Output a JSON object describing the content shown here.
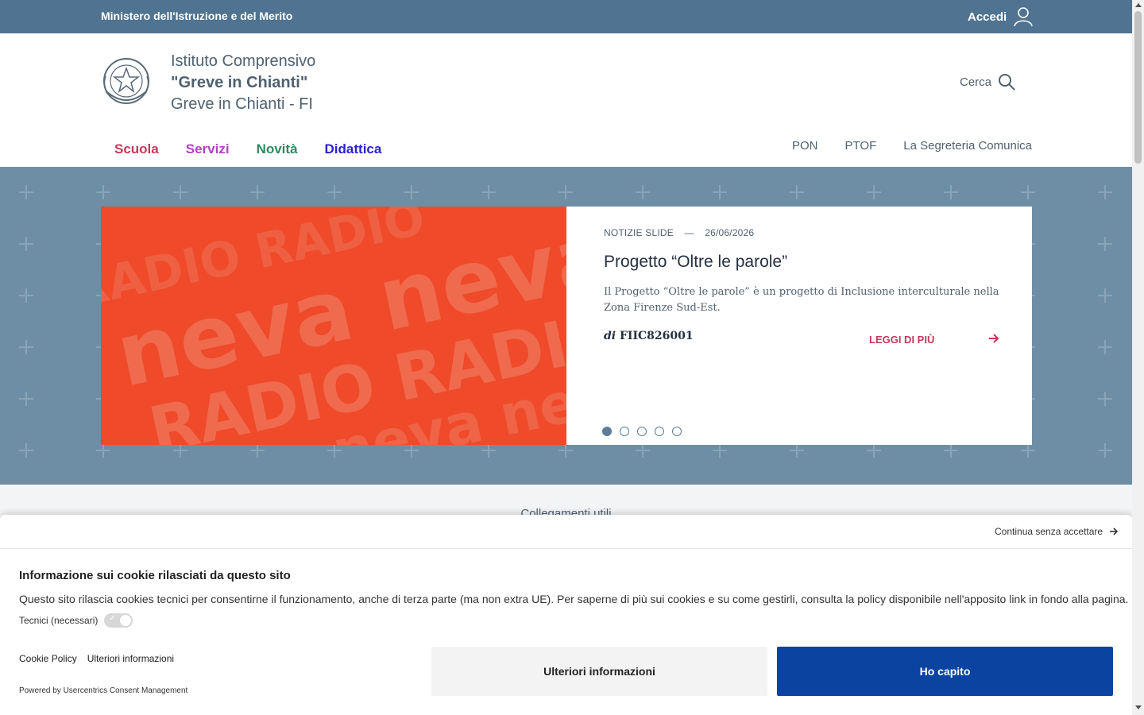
{
  "topbar": {
    "ministry": "Ministero dell'Istruzione e del Merito",
    "login_label": "Accedi"
  },
  "header": {
    "line1": "Istituto Comprensivo",
    "line2": "\"Greve in Chianti\"",
    "line3": "Greve in Chianti - FI",
    "search_label": "Cerca"
  },
  "mainnav": [
    "Scuola",
    "Servizi",
    "Novità",
    "Didattica"
  ],
  "subnav": [
    "PON",
    "PTOF",
    "La Segreteria Comunica"
  ],
  "slide": {
    "image_text_1": "neva neva",
    "image_text_2": "RADIO RADIO",
    "category": "NOTIZIE SLIDE",
    "separator": "—",
    "date": "26/06/2026",
    "title": "Progetto “Oltre le parole”",
    "description": "Il Progetto “Oltre le parole” è un progetto di Inclusione interculturale nella Zona Firenze Sud-Est.",
    "author_prefix": "di",
    "author": "FIIC826001",
    "read_more": "LEGGI DI PIÙ",
    "active_dot": 1,
    "dot_count": 5
  },
  "links": {
    "title": "Collegamenti utili"
  },
  "cookie": {
    "skip_label": "Continua senza accettare",
    "title": "Informazione sui cookie rilasciati da questo sito",
    "text": "Questo sito rilascia cookies tecnici per consentirne il funzionamento, anche di terza parte (ma non extra UE). Per saperne di più sui cookies e su come gestirli, consulta la policy disponibile nell'apposito link in fondo alla pagina.",
    "toggle_label": "Tecnici (necessari)",
    "policy_link": "Cookie Policy",
    "info_link": "Ulteriori informazioni",
    "powered_by": "Powered by Usercentrics Consent Management",
    "more_button": "Ulteriori informazioni",
    "ok_button": "Ho capito"
  },
  "colors": {
    "topbar": "#4f7390",
    "hero": "#6e8ea5",
    "accent_red": "#c7365a",
    "primary_button": "#0b43a0",
    "slide_image": "#ef4a2a"
  }
}
